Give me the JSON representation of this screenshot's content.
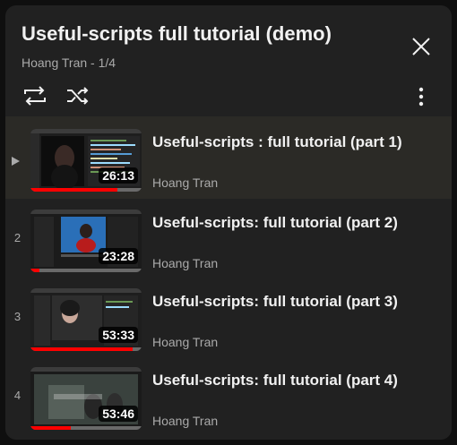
{
  "playlist": {
    "title": "Useful-scripts full tutorial (demo)",
    "subtitle": "Hoang Tran - 1/4"
  },
  "icons": {
    "close": "close-icon",
    "loop": "loop-icon",
    "shuffle": "shuffle-icon",
    "more": "more-vertical-icon",
    "now_playing": "play-indicator-icon"
  },
  "colors": {
    "panel_bg": "#212121",
    "active_row_bg": "#2b2a26",
    "progress_red": "#ff0000",
    "muted_text": "#aaaaaa"
  },
  "videos": [
    {
      "index": "",
      "title": "Useful-scripts : full tutorial (part 1)",
      "channel": "Hoang Tran",
      "duration": "26:13",
      "progress": 0.78,
      "active": true
    },
    {
      "index": "2",
      "title": "Useful-scripts: full tutorial (part 2)",
      "channel": "Hoang Tran",
      "duration": "23:28",
      "progress": 0.08,
      "active": false
    },
    {
      "index": "3",
      "title": "Useful-scripts: full tutorial (part 3)",
      "channel": "Hoang Tran",
      "duration": "53:33",
      "progress": 0.92,
      "active": false
    },
    {
      "index": "4",
      "title": "Useful-scripts: full tutorial (part 4)",
      "channel": "Hoang Tran",
      "duration": "53:46",
      "progress": 0.36,
      "active": false
    }
  ]
}
